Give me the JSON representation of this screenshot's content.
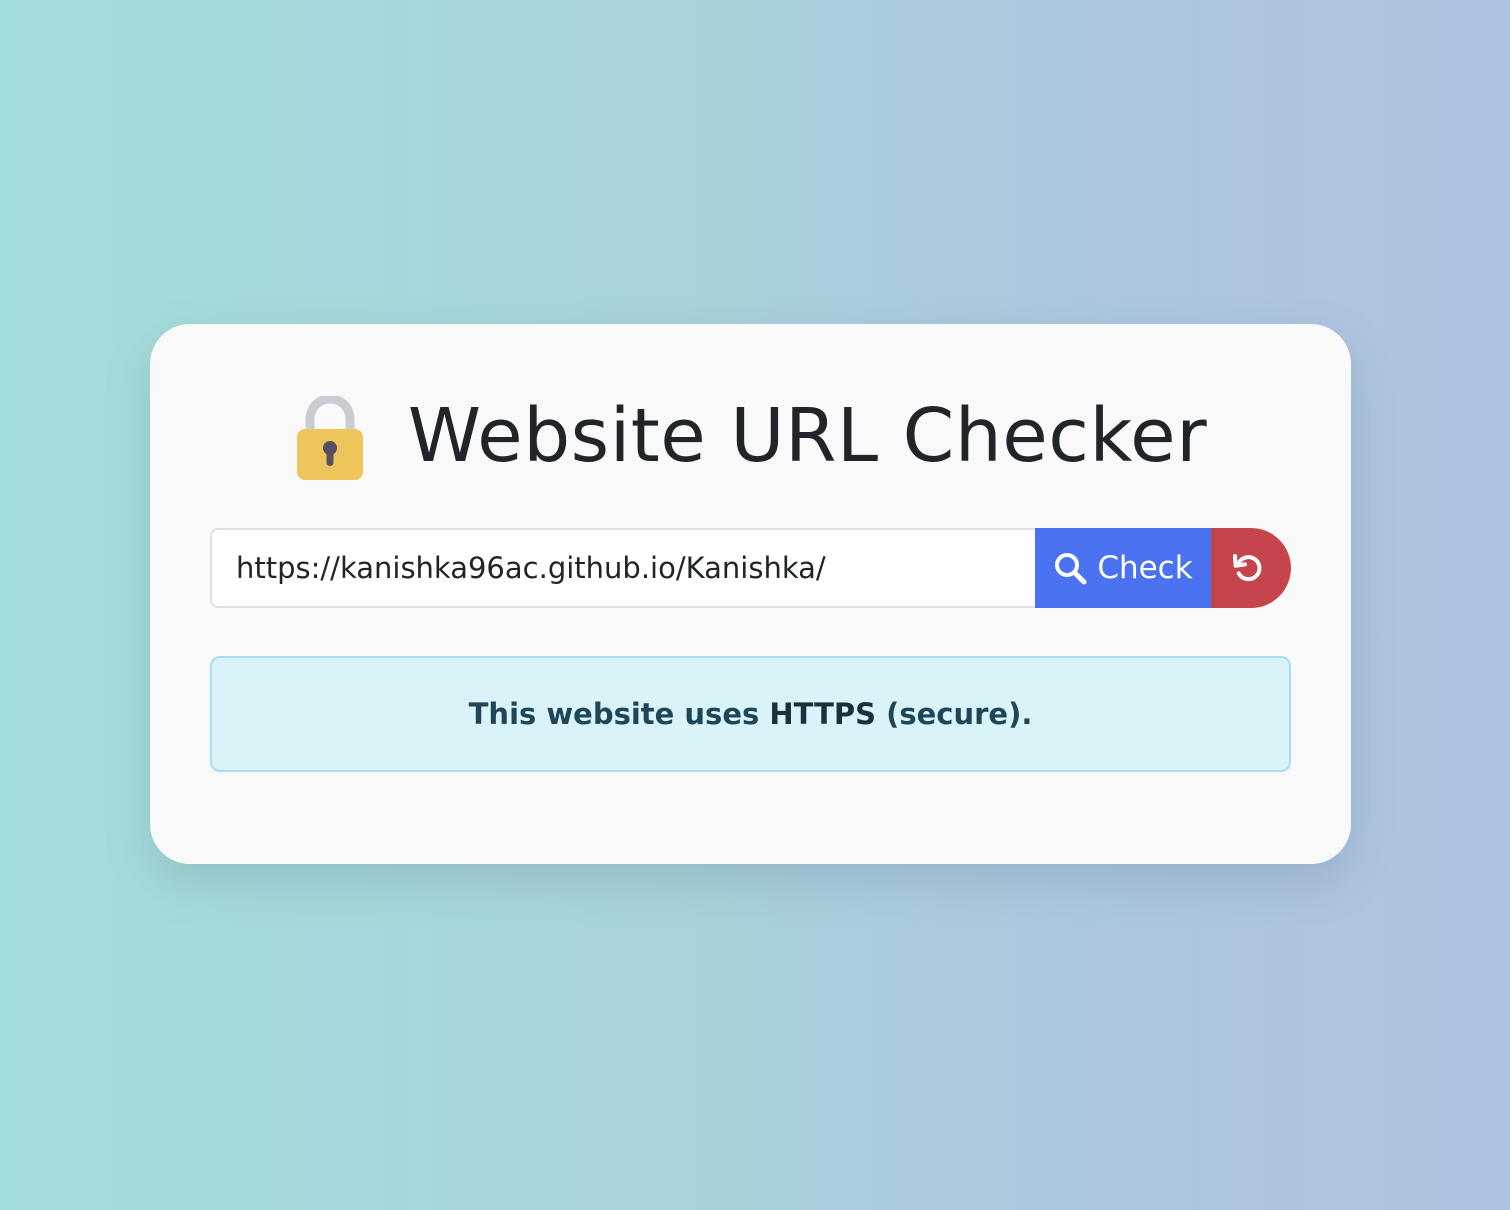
{
  "header": {
    "icon": "lock-icon",
    "title": "Website URL Checker"
  },
  "form": {
    "url_value": "https://kanishka96ac.github.io/Kanishka/",
    "check_label": "Check",
    "check_icon": "search-icon",
    "reset_icon": "reset-icon"
  },
  "result": {
    "prefix": "This website uses ",
    "protocol": "HTTPS",
    "suffix": " (secure)."
  },
  "colors": {
    "check_button": "#4a72f1",
    "reset_button": "#c6454d",
    "alert_background": "#d9f3f9",
    "alert_border": "#a8dfee",
    "title_text": "#212529"
  }
}
